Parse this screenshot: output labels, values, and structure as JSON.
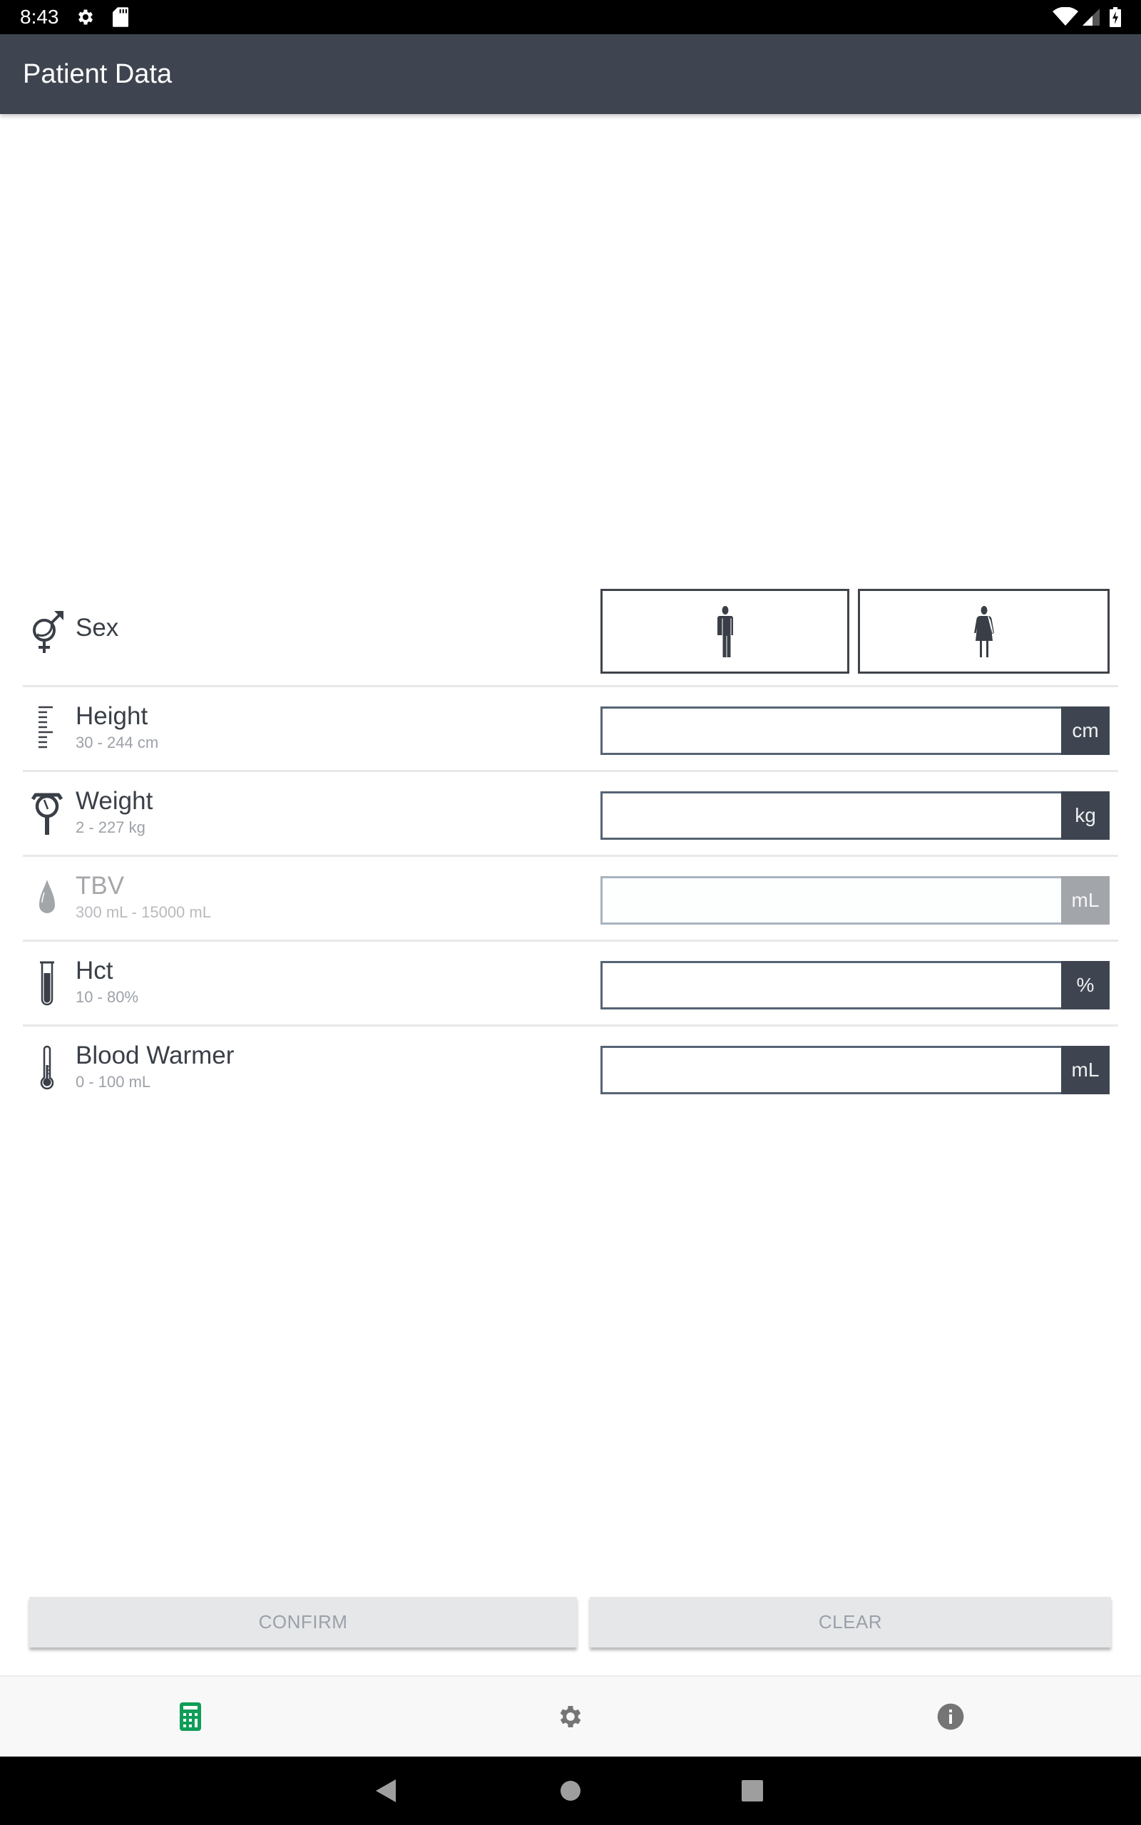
{
  "status_bar": {
    "time": "8:43",
    "left_icons": [
      "gear-icon",
      "sd-card-icon"
    ],
    "right_icons": [
      "wifi-icon",
      "cell-signal-icon",
      "battery-charging-icon"
    ]
  },
  "app_bar": {
    "title": "Patient Data"
  },
  "form": {
    "sex": {
      "label": "Sex",
      "icon": "gender-icon",
      "options": [
        {
          "name": "male",
          "icon": "male-figure-icon"
        },
        {
          "name": "female",
          "icon": "female-figure-icon"
        }
      ],
      "selected": null
    },
    "fields": [
      {
        "key": "height",
        "label": "Height",
        "range": "30 - 244 cm",
        "unit": "cm",
        "value": "",
        "placeholder": "",
        "icon": "ruler-icon",
        "enabled": true
      },
      {
        "key": "weight",
        "label": "Weight",
        "range": "2 - 227 kg",
        "unit": "kg",
        "value": "",
        "placeholder": "",
        "icon": "scale-icon",
        "enabled": true
      },
      {
        "key": "tbv",
        "label": "TBV",
        "range": "300 mL - 15000 mL",
        "unit": "mL",
        "value": "",
        "placeholder": "",
        "icon": "blood-drop-icon",
        "enabled": false
      },
      {
        "key": "hct",
        "label": "Hct",
        "range": "10 - 80%",
        "unit": "%",
        "value": "",
        "placeholder": "",
        "icon": "test-tube-icon",
        "enabled": true
      },
      {
        "key": "blood_warmer",
        "label": "Blood Warmer",
        "range": "0 - 100 mL",
        "unit": "mL",
        "value": "",
        "placeholder": "",
        "icon": "thermometer-icon",
        "enabled": true
      }
    ]
  },
  "actions": {
    "confirm_label": "CONFIRM",
    "clear_label": "CLEAR"
  },
  "bottom_nav": {
    "items": [
      {
        "name": "calculator",
        "icon": "calculator-icon",
        "active": true
      },
      {
        "name": "settings",
        "icon": "settings-icon",
        "active": false
      },
      {
        "name": "info",
        "icon": "info-icon",
        "active": false
      }
    ]
  },
  "colors": {
    "app_bar": "#3f4550",
    "active_nav": "#0f9d58",
    "inactive_nav": "#757575",
    "text_primary": "#3a3f47",
    "text_secondary": "#9ca1a8"
  }
}
